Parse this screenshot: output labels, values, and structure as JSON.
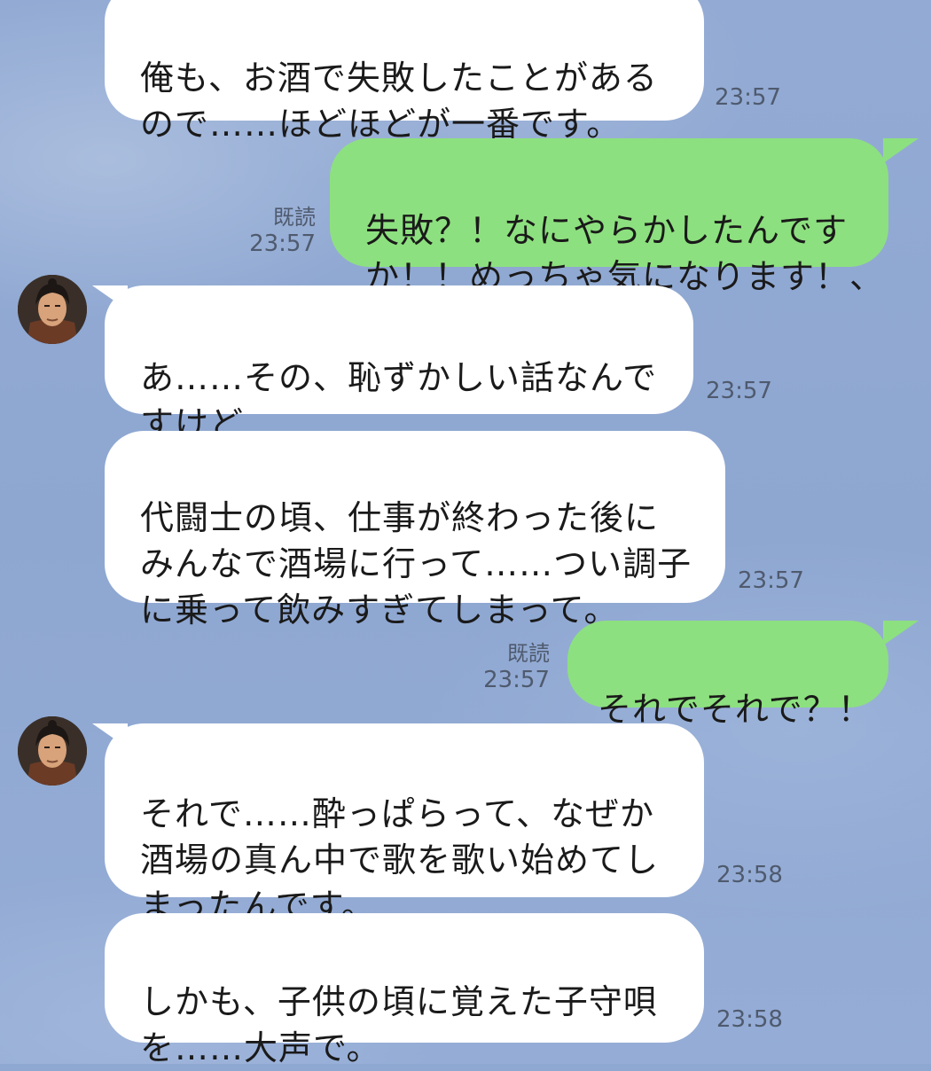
{
  "messages": [
    {
      "id": "m1",
      "side": "in",
      "text": "俺も、お酒で失敗したことがある\nので……ほどほどが一番です。",
      "time": "23:57"
    },
    {
      "id": "m2",
      "side": "out",
      "text": "失敗？！なにやらかしたんです\nか！！めっちゃ気になります！、",
      "read": "既読",
      "time": "23:57"
    },
    {
      "id": "m3",
      "side": "in",
      "text": "あ……その、恥ずかしい話なんで\nすけど……",
      "time": "23:57"
    },
    {
      "id": "m4",
      "side": "in",
      "text": "代闘士の頃、仕事が終わった後に\nみんなで酒場に行って……つい調子\nに乗って飲みすぎてしまって。",
      "time": "23:57"
    },
    {
      "id": "m5",
      "side": "out",
      "text": "それでそれで？！",
      "read": "既読",
      "time": "23:57"
    },
    {
      "id": "m6",
      "side": "in",
      "text": "それで……酔っぱらって、なぜか\n酒場の真ん中で歌を歌い始めてし\nまったんです。",
      "time": "23:58"
    },
    {
      "id": "m7",
      "side": "in",
      "text": "しかも、子供の頃に覚えた子守唄\nを……大声で。",
      "time": "23:58"
    }
  ],
  "colors": {
    "background": "#8fa8d2",
    "incoming_bubble": "#ffffff",
    "outgoing_bubble": "#8de07f",
    "meta_text": "#4f5a6e"
  },
  "icons": {
    "avatar": "character-avatar-icon"
  }
}
